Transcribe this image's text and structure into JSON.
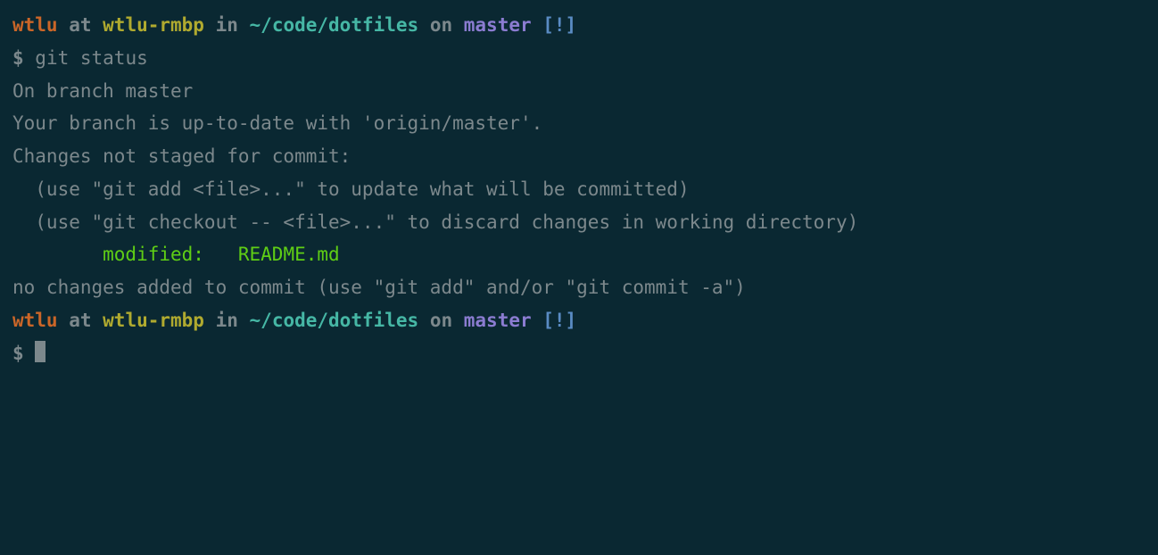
{
  "prompt1": {
    "user": "wtlu",
    "at": " at ",
    "host": "wtlu-rmbp",
    "in": " in ",
    "path": "~/code/dotfiles",
    "on": " on ",
    "branch": "master",
    "dirty": " [!]"
  },
  "command1": {
    "symbol": "$ ",
    "text": "git status"
  },
  "output": {
    "line1": "On branch master",
    "line2": "Your branch is up-to-date with 'origin/master'.",
    "line3": "",
    "line4": "Changes not staged for commit:",
    "line5": "  (use \"git add <file>...\" to update what will be committed)",
    "line6": "  (use \"git checkout -- <file>...\" to discard changes in working directory)",
    "line7": "",
    "modified_prefix": "        modified:   ",
    "modified_file": "README.md",
    "line9": "",
    "line10": "no changes added to commit (use \"git add\" and/or \"git commit -a\")",
    "line11": ""
  },
  "prompt2": {
    "user": "wtlu",
    "at": " at ",
    "host": "wtlu-rmbp",
    "in": " in ",
    "path": "~/code/dotfiles",
    "on": " on ",
    "branch": "master",
    "dirty": " [!]"
  },
  "command2": {
    "symbol": "$ "
  }
}
